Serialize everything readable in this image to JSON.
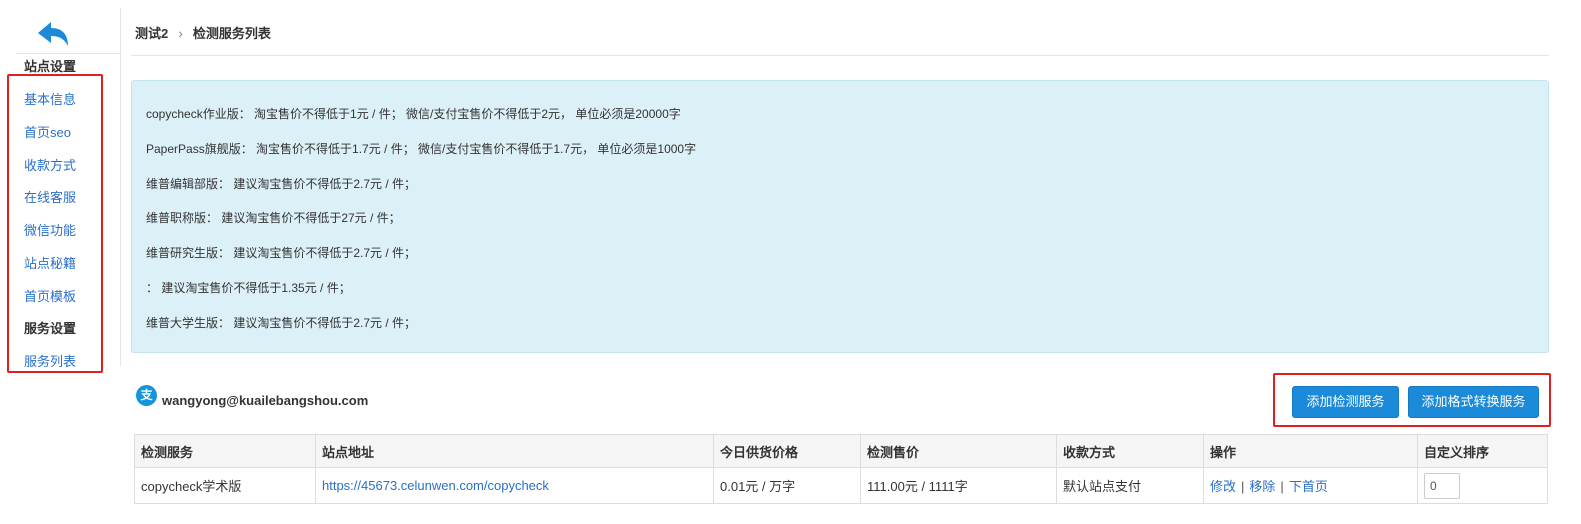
{
  "sidebar": {
    "site_heading": "站点设置",
    "site_items": [
      {
        "label": "基本信息"
      },
      {
        "label": "首页seo"
      },
      {
        "label": "收款方式"
      },
      {
        "label": "在线客服"
      },
      {
        "label": "微信功能"
      },
      {
        "label": "站点秘籍"
      },
      {
        "label": "首页模板"
      }
    ],
    "service_heading": "服务设置",
    "service_items": [
      {
        "label": "服务列表"
      }
    ]
  },
  "breadcrumb": {
    "parent": "测试2",
    "current": "检测服务列表"
  },
  "notice": {
    "lines": [
      "copycheck作业版： 淘宝售价不得低于1元 / 件； 微信/支付宝售价不得低于2元， 单位必须是20000字",
      "PaperPass旗舰版： 淘宝售价不得低于1.7元 / 件； 微信/支付宝售价不得低于1.7元， 单位必须是1000字",
      "维普编辑部版： 建议淘宝售价不得低于2.7元 / 件；",
      "维普职称版： 建议淘宝售价不得低于27元 / 件；",
      "维普研究生版： 建议淘宝售价不得低于2.7元 / 件；",
      "： 建议淘宝售价不得低于1.35元 / 件；",
      "维普大学生版： 建议淘宝售价不得低于2.7元 / 件；"
    ]
  },
  "account": {
    "icon_glyph": "支",
    "email": "wangyong@kuailebangshou.com"
  },
  "actions": {
    "add_check_service": "添加检测服务",
    "add_format_service": "添加格式转换服务"
  },
  "table": {
    "headers": [
      "检测服务",
      "站点地址",
      "今日供货价格",
      "检测售价",
      "收款方式",
      "操作",
      "自定义排序"
    ],
    "rows": [
      {
        "service": "copycheck学术版",
        "url": "https://45673.celunwen.com/copycheck",
        "supply_price": "0.01元 / 万字",
        "sale_price": "111.00元 / 1111字",
        "payment": "默认站点支付",
        "op_edit": "修改",
        "op_remove": "移除",
        "op_home": "下首页",
        "sort_value": "0"
      }
    ]
  },
  "colors": {
    "accent": "#1b8ad8",
    "link": "#2a6fc9",
    "notice_bg": "#dcf0f8",
    "highlight": "#e02020"
  }
}
